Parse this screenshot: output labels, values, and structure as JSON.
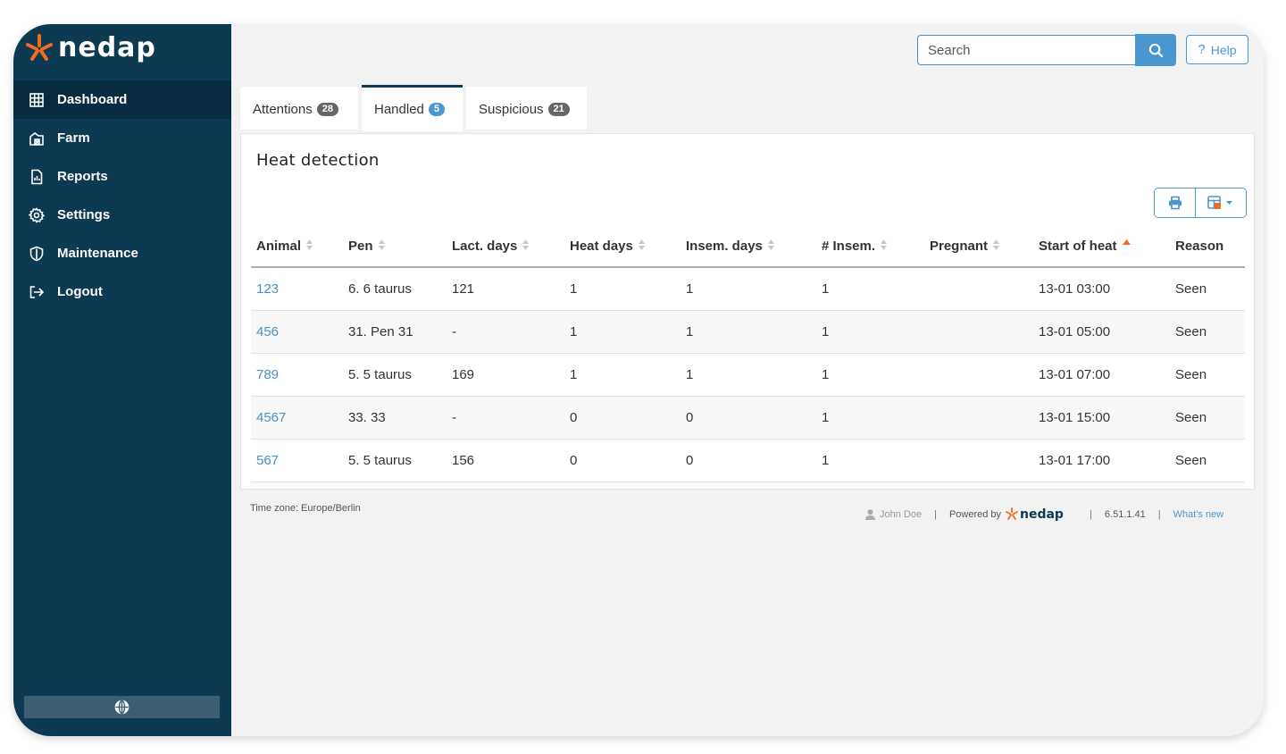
{
  "brand": {
    "name": "nedap",
    "accent": "#f26b1d",
    "primary": "#0b3a52",
    "link": "#4a97d0"
  },
  "sidebar": {
    "items": [
      {
        "label": "Dashboard",
        "icon": "grid-icon",
        "active": true
      },
      {
        "label": "Farm",
        "icon": "barn-icon"
      },
      {
        "label": "Reports",
        "icon": "report-icon"
      },
      {
        "label": "Settings",
        "icon": "gear-icon"
      },
      {
        "label": "Maintenance",
        "icon": "shield-icon"
      },
      {
        "label": "Logout",
        "icon": "logout-icon"
      }
    ],
    "language_icon": "globe-icon"
  },
  "header": {
    "search_placeholder": "Search",
    "help_label": "Help"
  },
  "tabs": [
    {
      "label": "Attentions",
      "count": "28"
    },
    {
      "label": "Handled",
      "count": "5",
      "active": true
    },
    {
      "label": "Suspicious",
      "count": "21"
    }
  ],
  "panel": {
    "title": "Heat detection",
    "columns": [
      "Animal",
      "Pen",
      "Lact. days",
      "Heat days",
      "Insem. days",
      "# Insem.",
      "Pregnant",
      "Start of heat",
      "Reason"
    ],
    "sorted_column": "Start of heat",
    "rows": [
      {
        "animal": "123",
        "pen": "6. 6 taurus",
        "lact": "121",
        "heat": "1",
        "insem_days": "1",
        "insem": "1",
        "pregnant": "",
        "start": "13-01 03:00",
        "reason": "Seen"
      },
      {
        "animal": "456",
        "pen": "31. Pen 31",
        "lact": "-",
        "heat": "1",
        "insem_days": "1",
        "insem": "1",
        "pregnant": "",
        "start": "13-01 05:00",
        "reason": "Seen"
      },
      {
        "animal": "789",
        "pen": "5. 5 taurus",
        "lact": "169",
        "heat": "1",
        "insem_days": "1",
        "insem": "1",
        "pregnant": "",
        "start": "13-01 07:00",
        "reason": "Seen"
      },
      {
        "animal": "4567",
        "pen": "33. 33",
        "lact": "-",
        "heat": "0",
        "insem_days": "0",
        "insem": "1",
        "pregnant": "",
        "start": "13-01 15:00",
        "reason": "Seen"
      },
      {
        "animal": "567",
        "pen": "5. 5 taurus",
        "lact": "156",
        "heat": "0",
        "insem_days": "0",
        "insem": "1",
        "pregnant": "",
        "start": "13-01 17:00",
        "reason": "Seen"
      }
    ]
  },
  "footer": {
    "timezone": "Time zone: Europe/Berlin",
    "user": "John Doe",
    "powered_by": "Powered by",
    "version": "6.51.1.41",
    "whats_new": "What's new"
  }
}
